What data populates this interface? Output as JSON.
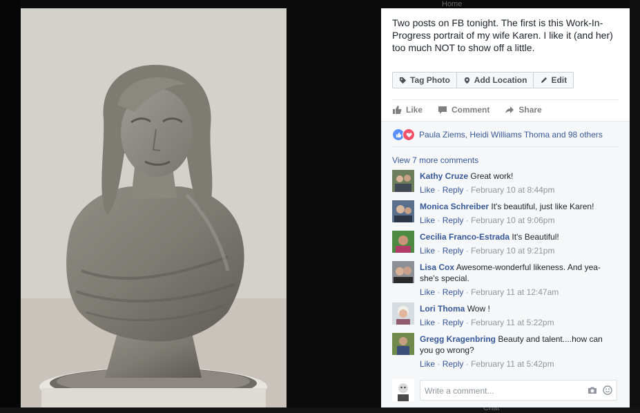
{
  "background": {
    "top_left_hint": "Home",
    "bottom_hint": "Chat"
  },
  "post": {
    "caption": "Two posts on FB tonight. The first is this Work-In-Progress portrait of my wife Karen. I like it (and her) too much NOT to show off a little.",
    "tag_photo": "Tag Photo",
    "add_location": "Add Location",
    "edit": "Edit"
  },
  "actions": {
    "like": "Like",
    "comment": "Comment",
    "share": "Share"
  },
  "reactions": {
    "summary": "Paula Ziems, Heidi Williams Thoma and 98 others",
    "icons": [
      "like-icon",
      "love-icon"
    ]
  },
  "view_more": "View 7 more comments",
  "comment_actions": {
    "like": "Like",
    "reply": "Reply",
    "separator": "·"
  },
  "comments": [
    {
      "author": "Kathy Cruze",
      "text": "Great work!",
      "time": "February 10 at 8:44pm"
    },
    {
      "author": "Monica Schreiber",
      "text": "It's beautiful, just like Karen!",
      "time": "February 10 at 9:06pm"
    },
    {
      "author": "Cecilia Franco-Estrada",
      "text": "It's Beautiful!",
      "time": "February 10 at 9:21pm"
    },
    {
      "author": "Lisa Cox",
      "text": "Awesome-wonderful likeness. And yea-she's special.",
      "time": "February 11 at 12:47am"
    },
    {
      "author": "Lori Thoma",
      "text": "Wow !",
      "time": "February 11 at 5:22pm"
    },
    {
      "author": "Gregg Kragenbring",
      "text": "Beauty and talent....how can you go wrong?",
      "time": "February 11 at 5:42pm"
    }
  ],
  "composer": {
    "placeholder": "Write a comment...",
    "icons": [
      "camera-icon",
      "emoji-icon"
    ]
  },
  "colors": {
    "link": "#365899",
    "text": "#1d2129",
    "muted": "#90949c",
    "like_blue": "#5890ff",
    "love_red": "#f25268"
  }
}
